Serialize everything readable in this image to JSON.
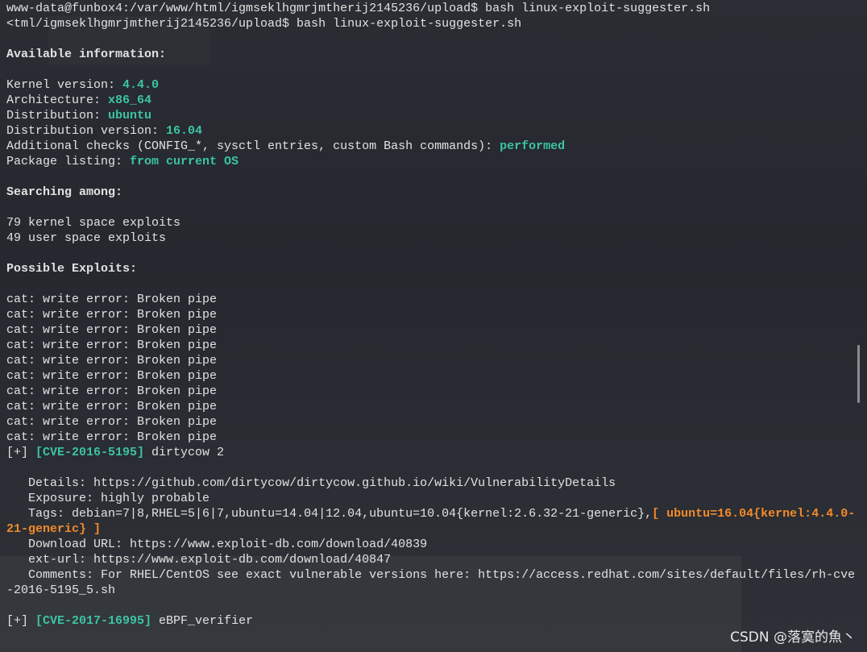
{
  "terminal": {
    "lines": [
      [
        [
          "www-data@funbox4:/var/www/html/igmseklhgmrjmtherij2145236/upload$ bash linux-exploit-suggester.sh",
          ""
        ]
      ],
      [
        [
          "<tml/igmseklhgmrjmtherij2145236/upload$ bash linux-exploit-suggester.sh",
          ""
        ]
      ],
      [],
      [
        [
          "Available information:",
          "bold"
        ]
      ],
      [],
      [
        [
          "Kernel version: ",
          ""
        ],
        [
          "4.4.0",
          "green"
        ]
      ],
      [
        [
          "Architecture: ",
          ""
        ],
        [
          "x86_64",
          "green"
        ]
      ],
      [
        [
          "Distribution: ",
          ""
        ],
        [
          "ubuntu",
          "green"
        ]
      ],
      [
        [
          "Distribution version: ",
          ""
        ],
        [
          "16.04",
          "green"
        ]
      ],
      [
        [
          "Additional checks (CONFIG_*, sysctl entries, custom Bash commands): ",
          ""
        ],
        [
          "performed",
          "green"
        ]
      ],
      [
        [
          "Package listing: ",
          ""
        ],
        [
          "from current OS",
          "green"
        ]
      ],
      [],
      [
        [
          "Searching among:",
          "bold"
        ]
      ],
      [],
      [
        [
          "79 kernel space exploits",
          ""
        ]
      ],
      [
        [
          "49 user space exploits",
          ""
        ]
      ],
      [],
      [
        [
          "Possible Exploits:",
          "bold"
        ]
      ],
      [],
      [
        [
          "cat: write error: Broken pipe",
          ""
        ]
      ],
      [
        [
          "cat: write error: Broken pipe",
          ""
        ]
      ],
      [
        [
          "cat: write error: Broken pipe",
          ""
        ]
      ],
      [
        [
          "cat: write error: Broken pipe",
          ""
        ]
      ],
      [
        [
          "cat: write error: Broken pipe",
          ""
        ]
      ],
      [
        [
          "cat: write error: Broken pipe",
          ""
        ]
      ],
      [
        [
          "cat: write error: Broken pipe",
          ""
        ]
      ],
      [
        [
          "cat: write error: Broken pipe",
          ""
        ]
      ],
      [
        [
          "cat: write error: Broken pipe",
          ""
        ]
      ],
      [
        [
          "cat: write error: Broken pipe",
          ""
        ]
      ],
      [
        [
          "[+] ",
          ""
        ],
        [
          "[CVE-2016-5195]",
          "green"
        ],
        [
          " dirtycow 2",
          ""
        ]
      ],
      [],
      [
        [
          "   Details: https://github.com/dirtycow/dirtycow.github.io/wiki/VulnerabilityDetails",
          ""
        ]
      ],
      [
        [
          "   Exposure: highly probable",
          ""
        ]
      ],
      [
        [
          "   Tags: debian=7|8,RHEL=5|6|7,ubuntu=14.04|12.04,ubuntu=10.04{kernel:2.6.32-21-generic},",
          ""
        ],
        [
          "[ ubuntu=16.04{kernel:4.4.0-21-generic} ]",
          "orange"
        ]
      ],
      [
        [
          "   Download URL: https://www.exploit-db.com/download/40839",
          ""
        ]
      ],
      [
        [
          "   ext-url: https://www.exploit-db.com/download/40847",
          ""
        ]
      ],
      [
        [
          "   Comments: For RHEL/CentOS see exact vulnerable versions here: https://access.redhat.com/sites/default/files/rh-cve-2016-5195_5.sh",
          ""
        ]
      ],
      [],
      [
        [
          "[+] ",
          ""
        ],
        [
          "[CVE-2017-16995]",
          "green"
        ],
        [
          " eBPF_verifier",
          ""
        ]
      ]
    ]
  },
  "watermark": "CSDN @落寞的魚丶",
  "colors": {
    "background": "#26292f",
    "text": "#e2e2e2",
    "highlight": "#3cc4a2",
    "warning": "#f28a2a"
  }
}
